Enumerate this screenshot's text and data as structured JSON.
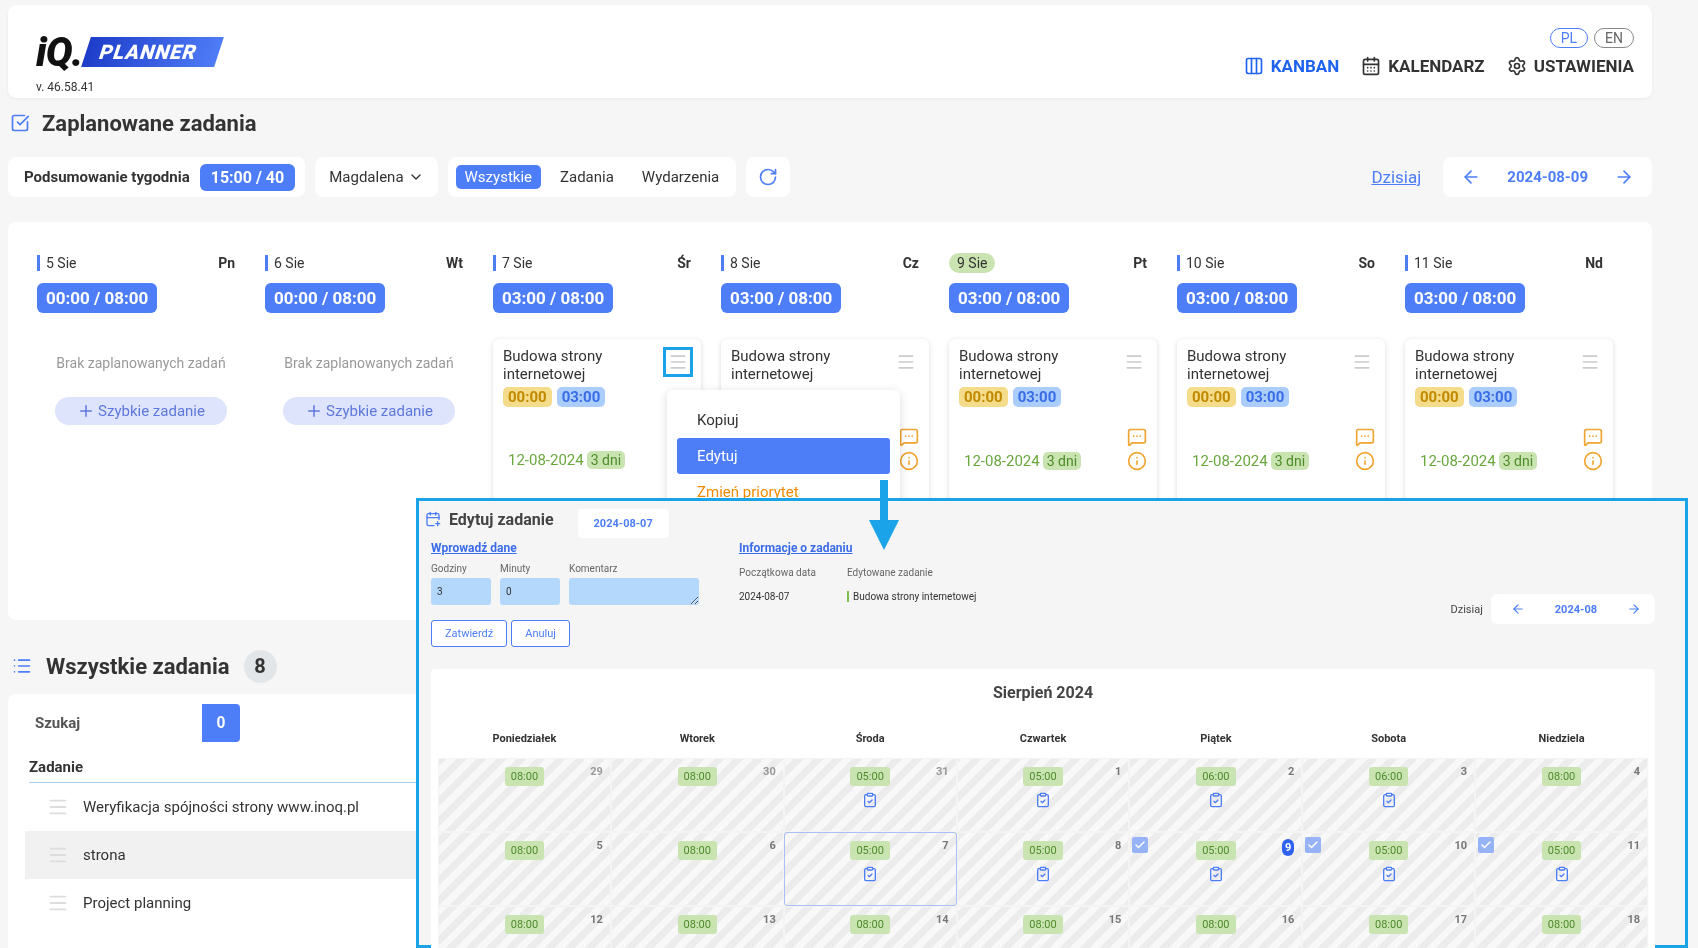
{
  "header": {
    "logo": {
      "mark": "iQ.",
      "name": "PLANNER"
    },
    "version": "v. 46.58.41",
    "languages": [
      {
        "label": "PL",
        "selected": true
      },
      {
        "label": "EN",
        "selected": false
      }
    ],
    "nav": [
      {
        "label": "KANBAN",
        "kind": "kanban",
        "selected": true
      },
      {
        "label": "KALENDARZ",
        "kind": "calendar",
        "selected": false
      },
      {
        "label": "USTAWIENIA",
        "kind": "settings",
        "selected": false
      }
    ]
  },
  "page_title": "Zaplanowane zadania",
  "toolbar": {
    "summary_label": "Podsumowanie tygodnia",
    "summary_value": "15:00 / 40",
    "person": "Magdalena",
    "filters": [
      {
        "label": "Wszystkie",
        "selected": true
      },
      {
        "label": "Zadania",
        "selected": false
      },
      {
        "label": "Wydarzenia",
        "selected": false
      }
    ],
    "today_link": "Dzisiaj",
    "date": "2024-08-09"
  },
  "days": [
    {
      "date": "5 Sie",
      "weekday": "Pn",
      "today": false,
      "total": "00:00 / 08:00",
      "empty_text": "Brak zaplanowanych zadań",
      "quick_add": "Szybkie zadanie"
    },
    {
      "date": "6 Sie",
      "weekday": "Wt",
      "today": false,
      "total": "00:00 / 08:00",
      "empty_text": "Brak zaplanowanych zadań",
      "quick_add": "Szybkie zadanie"
    },
    {
      "date": "7 Sie",
      "weekday": "Śr",
      "today": false,
      "total": "03:00 / 08:00",
      "card": {
        "title": "Budowa strony internetowej",
        "menu_open": true,
        "icons_visible": false,
        "spent": "00:00",
        "planned": "03:00",
        "due": "12-08-2024",
        "days_left": "3 dni"
      }
    },
    {
      "date": "8 Sie",
      "weekday": "Cz",
      "today": false,
      "total": "03:00 / 08:00",
      "card": {
        "title": "Budowa strony internetowej",
        "menu_open": false,
        "icons_visible": true
      }
    },
    {
      "date": "9 Sie",
      "weekday": "Pt",
      "today": true,
      "total": "03:00 / 08:00",
      "card": {
        "title": "Budowa strony internetowej",
        "menu_open": false,
        "icons_visible": true,
        "spent": "00:00",
        "planned": "03:00",
        "due": "12-08-2024",
        "days_left": "3 dni"
      }
    },
    {
      "date": "10 Sie",
      "weekday": "So",
      "today": false,
      "total": "03:00 / 08:00",
      "card": {
        "title": "Budowa strony internetowej",
        "menu_open": false,
        "icons_visible": true,
        "spent": "00:00",
        "planned": "03:00",
        "due": "12-08-2024",
        "days_left": "3 dni"
      }
    },
    {
      "date": "11 Sie",
      "weekday": "Nd",
      "today": false,
      "total": "03:00 / 08:00",
      "card": {
        "title": "Budowa strony internetowej",
        "menu_open": false,
        "icons_visible": true,
        "spent": "00:00",
        "planned": "03:00",
        "due": "12-08-2024",
        "days_left": "3 dni"
      }
    }
  ],
  "context_menu": {
    "items": [
      {
        "label": "Kopiuj",
        "kind": "normal",
        "selected": false
      },
      {
        "label": "Edytuj",
        "kind": "normal",
        "selected": true
      },
      {
        "label": "Zmień priorytet",
        "kind": "warning",
        "selected": false
      }
    ]
  },
  "all_tasks": {
    "title": "Wszystkie zadania",
    "count": "8",
    "search_label": "Szukaj",
    "search_count": "0",
    "column": "Zadanie",
    "rows": [
      {
        "label": "Weryfikacja spójności strony www.inoq.pl",
        "selected": false
      },
      {
        "label": "strona",
        "selected": true
      },
      {
        "label": "Project planning",
        "selected": false
      }
    ]
  },
  "edit_panel": {
    "title": "Edytuj zadanie",
    "date_tab": "2024-08-07",
    "input_heading": "Wprowadź dane",
    "fields": [
      {
        "label": "Godziny",
        "value": "3",
        "kind": "short"
      },
      {
        "label": "Minuty",
        "value": "0",
        "kind": "short"
      },
      {
        "label": "Komentarz",
        "kind": "textarea"
      }
    ],
    "buttons": [
      "Zatwierdź",
      "Anuluj"
    ],
    "info_heading": "Informacje o zadaniu",
    "start_label": "Początkowa data",
    "start_value": "2024-08-07",
    "task_label": "Edytowane zadanie",
    "task_value": "Budowa strony internetowej",
    "today_link": "Dzisiaj",
    "month_nav": "2024-08",
    "calendar": {
      "title": "Sierpień 2024",
      "weekdays": [
        "Poniedziałek",
        "Wtorek",
        "Środa",
        "Czwartek",
        "Piątek",
        "Sobota",
        "Niedziela"
      ],
      "weeks": [
        [
          {
            "day": "29",
            "hours": "08:00",
            "outside": true,
            "task": false,
            "checked": false,
            "today": false,
            "selected": false
          },
          {
            "day": "30",
            "hours": "08:00",
            "outside": true,
            "task": false,
            "checked": false,
            "today": false,
            "selected": false
          },
          {
            "day": "31",
            "hours": "05:00",
            "outside": true,
            "task": true,
            "checked": false,
            "today": false,
            "selected": false
          },
          {
            "day": "1",
            "hours": "05:00",
            "outside": false,
            "task": true,
            "checked": false,
            "today": false,
            "selected": false
          },
          {
            "day": "2",
            "hours": "06:00",
            "outside": false,
            "task": true,
            "checked": false,
            "today": false,
            "selected": false
          },
          {
            "day": "3",
            "hours": "06:00",
            "outside": false,
            "task": true,
            "checked": false,
            "today": false,
            "selected": false
          },
          {
            "day": "4",
            "hours": "08:00",
            "outside": false,
            "task": false,
            "checked": false,
            "today": false,
            "selected": false
          }
        ],
        [
          {
            "day": "5",
            "hours": "08:00",
            "outside": false,
            "task": false,
            "checked": false,
            "today": false,
            "selected": false
          },
          {
            "day": "6",
            "hours": "08:00",
            "outside": false,
            "task": false,
            "checked": false,
            "today": false,
            "selected": false
          },
          {
            "day": "7",
            "hours": "05:00",
            "outside": false,
            "task": true,
            "checked": false,
            "today": false,
            "selected": true
          },
          {
            "day": "8",
            "hours": "05:00",
            "outside": false,
            "task": true,
            "checked": false,
            "today": false,
            "selected": false
          },
          {
            "day": "9",
            "hours": "05:00",
            "outside": false,
            "task": true,
            "checked": true,
            "today": true,
            "selected": false
          },
          {
            "day": "10",
            "hours": "05:00",
            "outside": false,
            "task": true,
            "checked": true,
            "today": false,
            "selected": false
          },
          {
            "day": "11",
            "hours": "05:00",
            "outside": false,
            "task": true,
            "checked": true,
            "today": false,
            "selected": false
          }
        ],
        [
          {
            "day": "12",
            "hours": "08:00",
            "outside": false,
            "task": false,
            "checked": false,
            "today": false,
            "selected": false
          },
          {
            "day": "13",
            "hours": "08:00",
            "outside": false,
            "task": false,
            "checked": false,
            "today": false,
            "selected": false
          },
          {
            "day": "14",
            "hours": "08:00",
            "outside": false,
            "task": false,
            "checked": false,
            "today": false,
            "selected": false
          },
          {
            "day": "15",
            "hours": "08:00",
            "outside": false,
            "task": false,
            "checked": false,
            "today": false,
            "selected": false
          },
          {
            "day": "16",
            "hours": "08:00",
            "outside": false,
            "task": false,
            "checked": false,
            "today": false,
            "selected": false
          },
          {
            "day": "17",
            "hours": "08:00",
            "outside": false,
            "task": false,
            "checked": false,
            "today": false,
            "selected": false
          },
          {
            "day": "18",
            "hours": "08:00",
            "outside": false,
            "task": false,
            "checked": false,
            "today": false,
            "selected": false
          }
        ]
      ]
    }
  }
}
